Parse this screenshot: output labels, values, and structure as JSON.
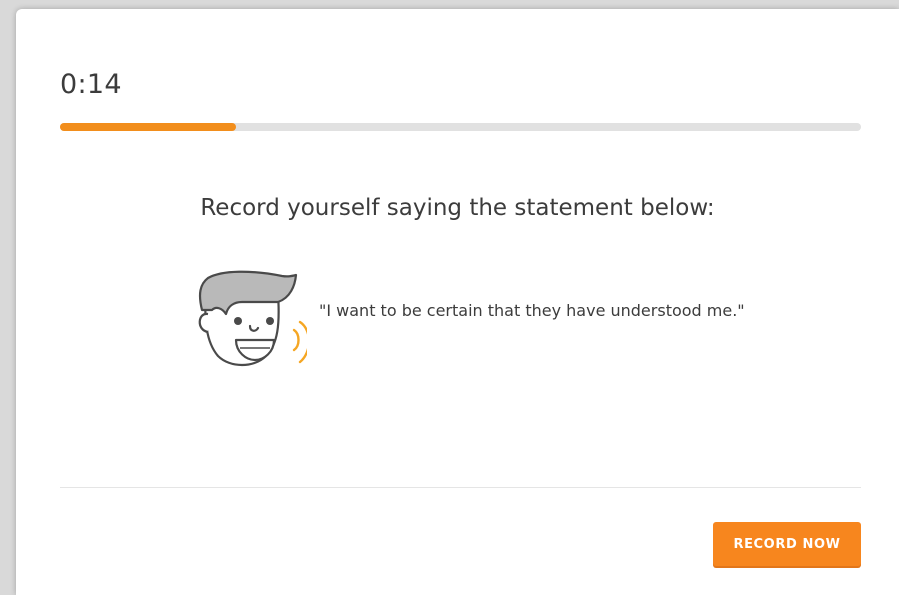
{
  "timer": {
    "elapsed": "0:14",
    "progress_percent": 22
  },
  "prompt": {
    "instruction": "Record yourself saying the statement below:",
    "statement": "\"I want to be certain that they have understood me.\"",
    "speaker_icon": "speaking-face-icon"
  },
  "actions": {
    "record_label": "RECORD NOW"
  },
  "colors": {
    "accent": "#f7861e",
    "progress_fill": "#f28e1c",
    "progress_track": "#e1e1e1",
    "text": "#3c3c3c"
  }
}
